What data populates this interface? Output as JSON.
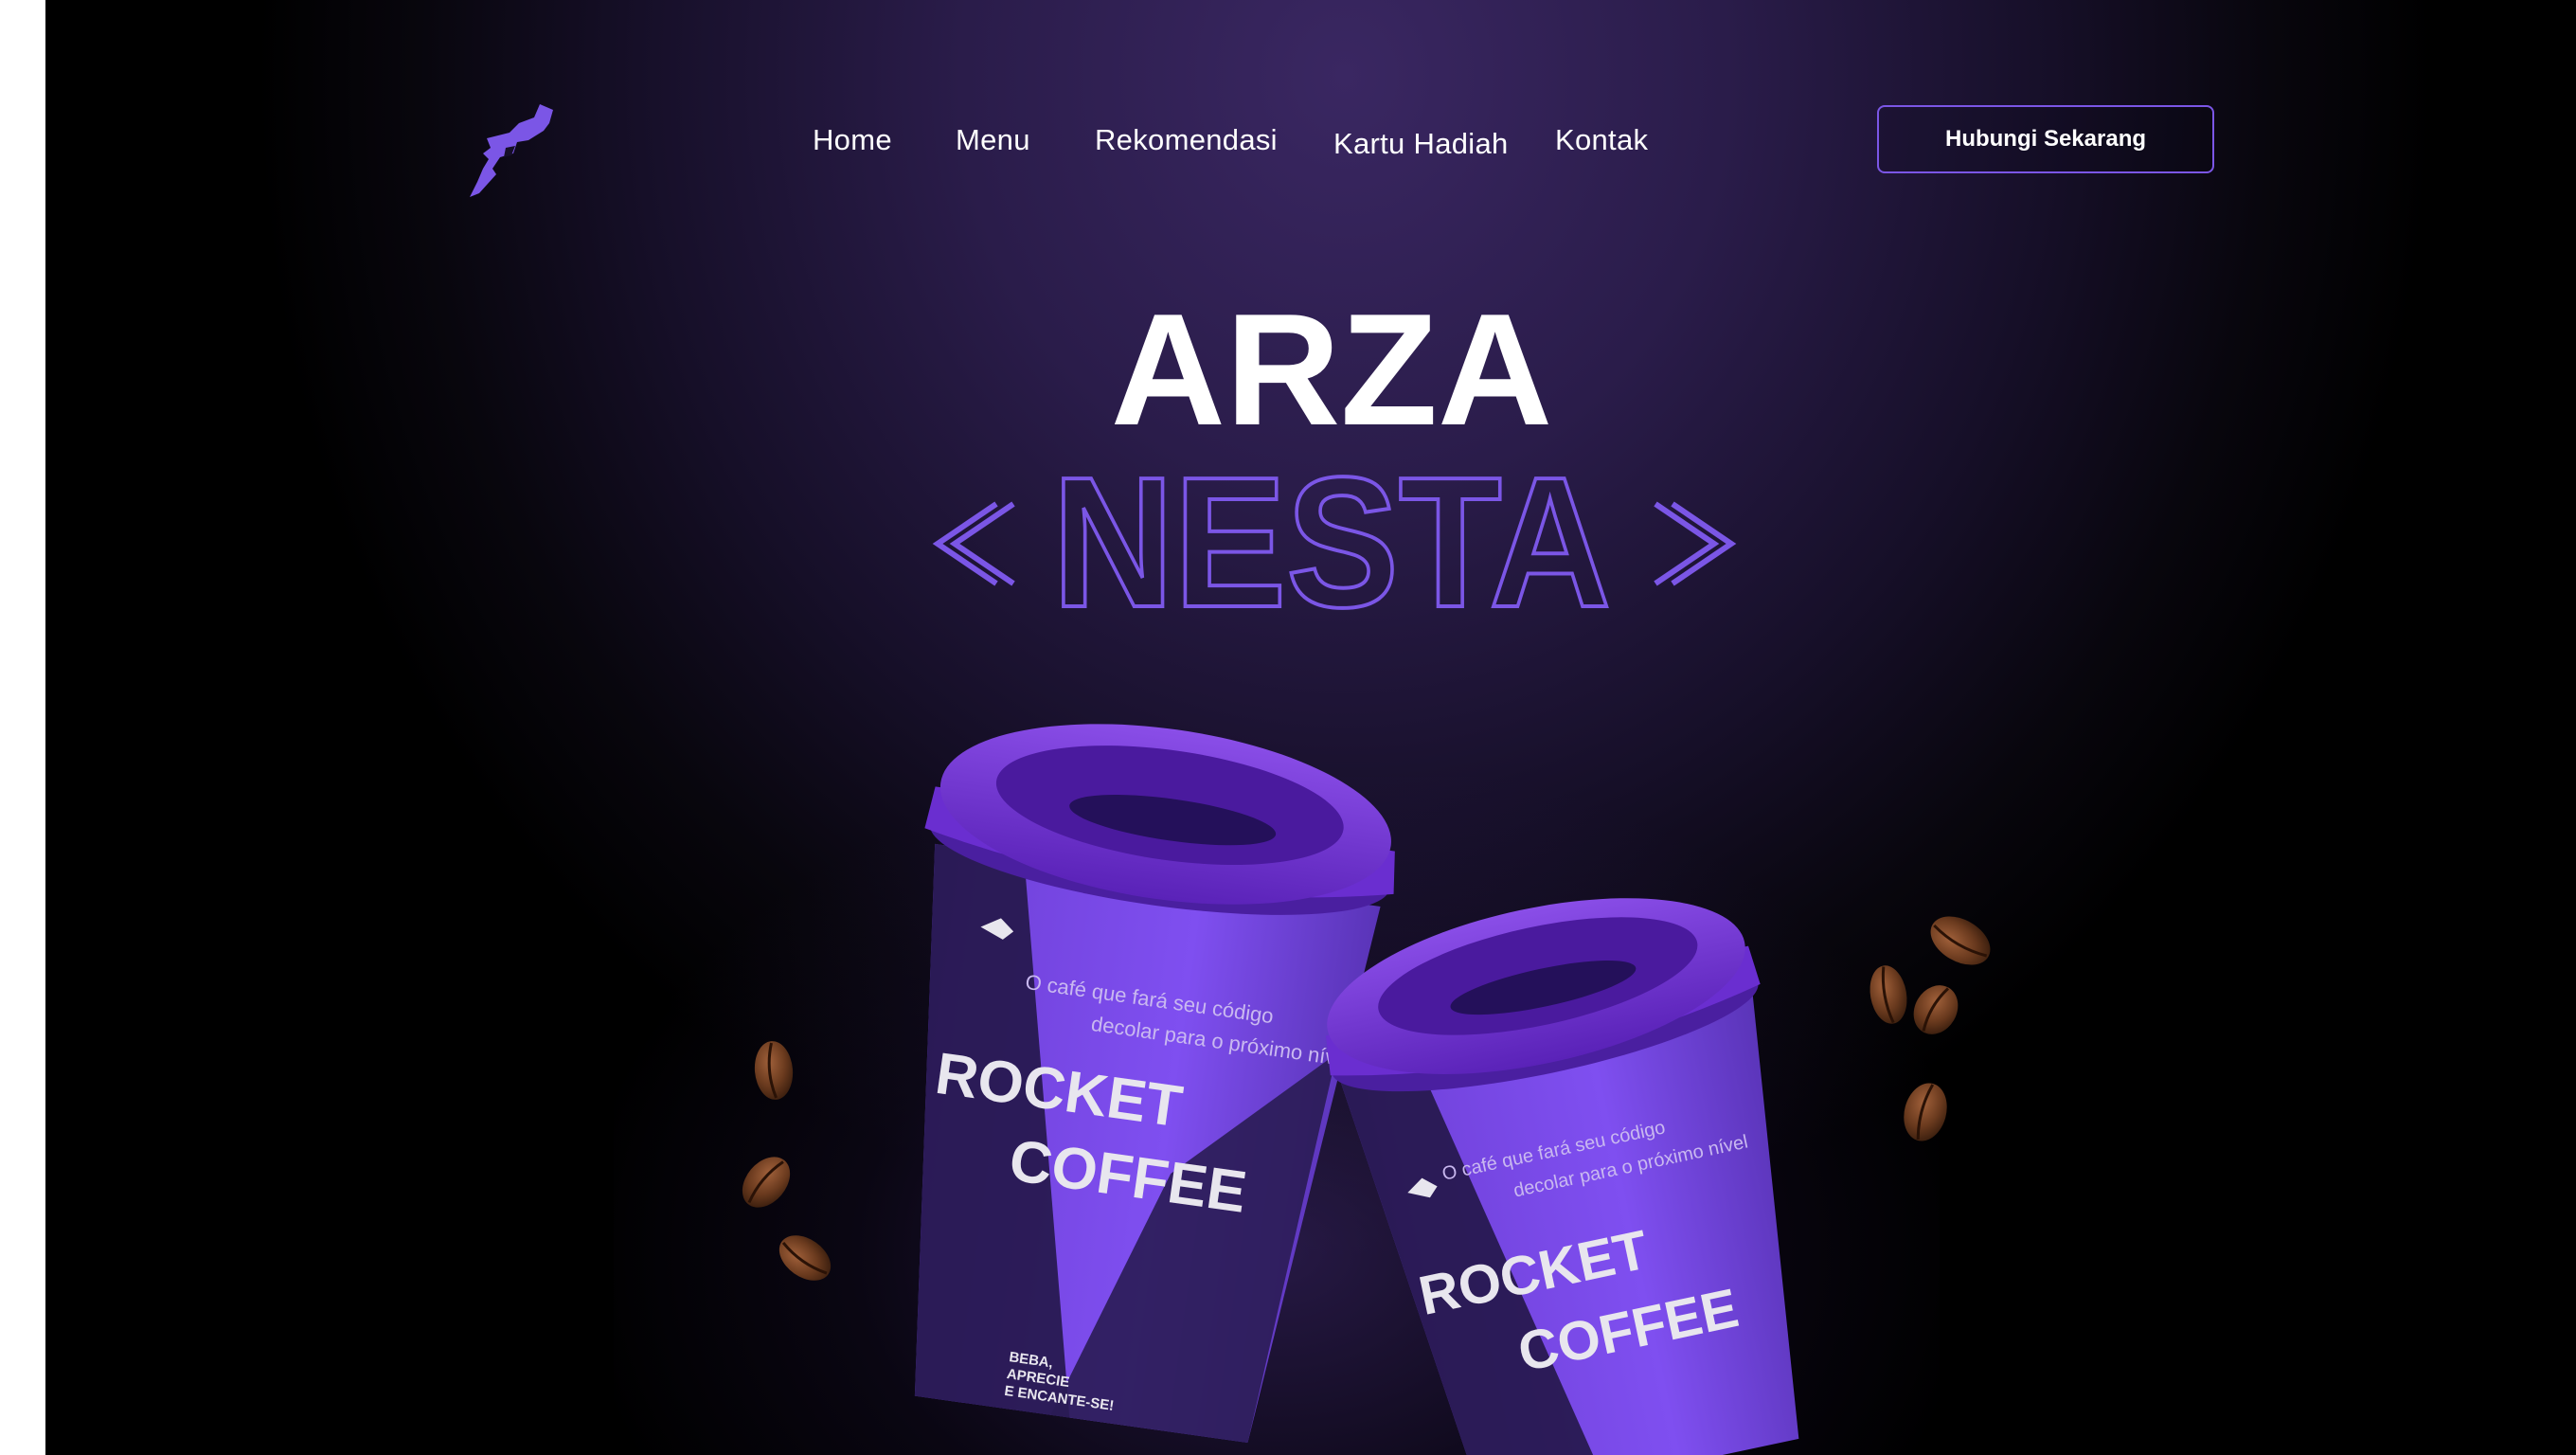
{
  "nav": {
    "items": [
      {
        "label": "Home"
      },
      {
        "label": "Menu"
      },
      {
        "label": "Rekomendasi"
      },
      {
        "label": "Kartu Hadiah"
      },
      {
        "label": "Kontak"
      }
    ],
    "cta_label": "Hubungi Sekarang"
  },
  "hero": {
    "line1": "ARZA",
    "line2": "NESTA",
    "accent_color": "#7b56e6"
  },
  "product": {
    "cup1": {
      "tagline_1": "O café que fará seu código",
      "tagline_2": "decolar para o próximo nível",
      "brand_1": "ROCKET",
      "brand_2": "COFFEE",
      "bottom_1": "BEBA,",
      "bottom_2": "APRECIE",
      "bottom_3": "E ENCANTE-SE!"
    },
    "cup2": {
      "tagline_1": "O café que fará seu código",
      "tagline_2": "decolar para o próximo nível",
      "brand_1": "ROCKET",
      "brand_2": "COFFEE"
    }
  },
  "icons": {
    "logo": "rocket-logo-icon",
    "beans": "coffee-bean-icon"
  }
}
